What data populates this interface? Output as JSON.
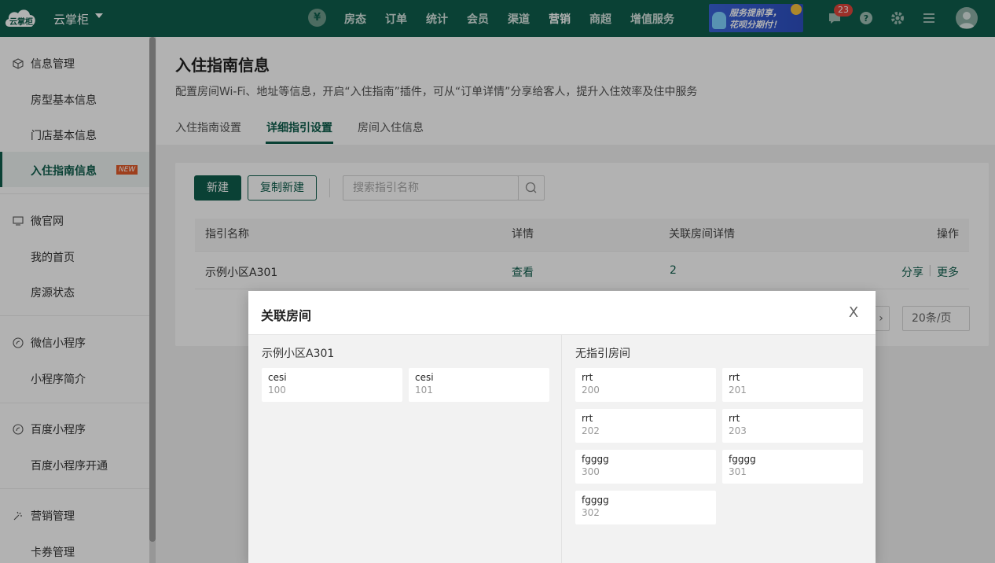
{
  "topbar": {
    "brand": "云掌柜",
    "logo_text": "云掌柜",
    "yen_symbol": "¥",
    "nav": [
      "房态",
      "订单",
      "统计",
      "会员",
      "渠道",
      "营销",
      "商超",
      "增值服务"
    ],
    "active_nav": "营销",
    "promo_line1": "服务提前享，",
    "promo_line2": "花呗分期付！",
    "notification_count": "23",
    "icons": [
      "message-icon",
      "help-icon",
      "settings-icon",
      "menu-icon",
      "avatar"
    ]
  },
  "sidebar": {
    "groups": [
      {
        "title": "信息管理",
        "icon": "cube-icon",
        "items": [
          "房型基本信息",
          "门店基本信息",
          "入住指南信息"
        ]
      },
      {
        "title": "微官网",
        "icon": "monitor-icon",
        "items": [
          "我的首页",
          "房源状态"
        ]
      },
      {
        "title": "微信小程序",
        "icon": "mini-program-icon",
        "items": [
          "小程序简介"
        ]
      },
      {
        "title": "百度小程序",
        "icon": "baidu-program-icon",
        "items": [
          "百度小程序开通"
        ]
      },
      {
        "title": "营销管理",
        "icon": "marketing-icon",
        "items": [
          "卡券管理"
        ]
      }
    ],
    "active_item": "入住指南信息",
    "new_badge": "NEW"
  },
  "main": {
    "title": "入住指南信息",
    "description": "配置房间Wi-Fi、地址等信息，开启“入住指南”插件，可从“订单详情”分享给客人，提升入住效率及住中服务",
    "tabs": [
      "入住指南设置",
      "详细指引设置",
      "房间入住信息"
    ],
    "active_tab": "详细指引设置",
    "new_button": "新建",
    "copy_button": "复制新建",
    "search_placeholder": "搜索指引名称",
    "table": {
      "headers": [
        "指引名称",
        "详情",
        "关联房间详情",
        "操作"
      ],
      "rows": [
        {
          "name": "示例小区A301",
          "detail": "查看",
          "rooms": "2",
          "share": "分享",
          "more": "更多"
        }
      ],
      "action_separator": "|"
    },
    "pager": {
      "next": "›",
      "page_size": "20条/页"
    }
  },
  "modal": {
    "title": "关联房间",
    "close": "X",
    "left_title": "示例小区A301",
    "left_rooms": [
      {
        "name": "cesi",
        "code": "100"
      },
      {
        "name": "cesi",
        "code": "101"
      }
    ],
    "right_title": "无指引房间",
    "right_rooms": [
      {
        "name": "rrt",
        "code": "200"
      },
      {
        "name": "rrt",
        "code": "201"
      },
      {
        "name": "rrt",
        "code": "202"
      },
      {
        "name": "rrt",
        "code": "203"
      },
      {
        "name": "fgggg",
        "code": "300"
      },
      {
        "name": "fgggg",
        "code": "301"
      },
      {
        "name": "fgggg",
        "code": "302"
      }
    ]
  },
  "colors": {
    "brand": "#0f5e4c",
    "badge": "#e0453b",
    "new_badge": "#e35b2a"
  }
}
